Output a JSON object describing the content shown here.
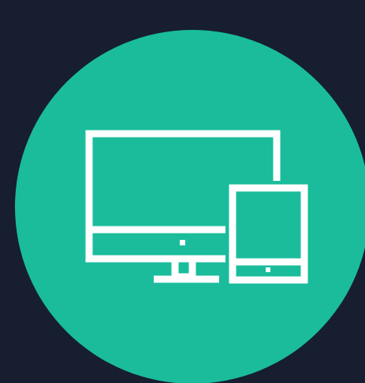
{
  "colors": {
    "background": "#161e30",
    "circle": "#1abc9c",
    "icon_stroke": "#ffffff"
  },
  "icon": {
    "name": "responsive-devices-icon",
    "parts": [
      "desktop-monitor-icon",
      "tablet-icon"
    ]
  }
}
